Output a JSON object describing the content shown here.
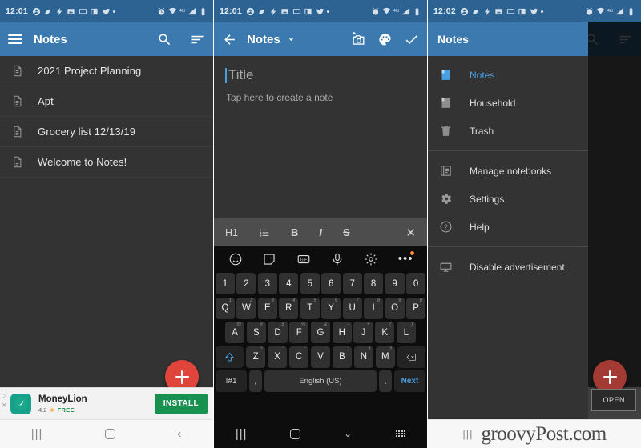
{
  "colors": {
    "appbar_blue": "#3b79ae",
    "statusbar_blue": "#2d6392",
    "body_dark": "#333333",
    "fab_red": "#e0453c",
    "accent_blue": "#4a9fe0",
    "keyboard_black": "#0d0d0d",
    "ad_green": "#17914f"
  },
  "panel1": {
    "status": {
      "time": "12:01",
      "icons": [
        "account-icon",
        "leaf-icon",
        "flash-icon",
        "image-icon",
        "monitor-icon",
        "book-icon",
        "twitter-icon",
        "dot-icon"
      ],
      "right_icons": [
        "alarm-icon",
        "wifi-icon",
        "4g-label",
        "signal-icon",
        "battery-icon"
      ],
      "network_label": "4G"
    },
    "appbar": {
      "menu_icon": "hamburger-icon",
      "title": "Notes",
      "search_icon": "search-icon",
      "sort_icon": "sort-icon"
    },
    "notes": [
      {
        "icon": "document-icon",
        "label": "2021 Project Planning"
      },
      {
        "icon": "document-icon",
        "label": "Apt"
      },
      {
        "icon": "document-icon",
        "label": "Grocery list 12/13/19"
      },
      {
        "icon": "document-icon",
        "label": "Welcome to Notes!"
      }
    ],
    "fab": {
      "icon": "plus-icon",
      "label": "+"
    },
    "ad": {
      "title": "MoneyLion",
      "rating": "4.2",
      "star": "★",
      "price": "FREE",
      "button": "INSTALL",
      "logo_icon": "moneylion-logo-icon"
    },
    "navbar": {
      "recents": "|||",
      "home": "home-circle-icon",
      "back": "‹"
    }
  },
  "panel2": {
    "status": {
      "time": "12:01"
    },
    "appbar": {
      "back_icon": "back-arrow-icon",
      "title": "Notes",
      "dropdown_icon": "chevron-down-icon",
      "camera_icon": "add-photo-icon",
      "palette_icon": "palette-icon",
      "check_icon": "check-icon"
    },
    "editor": {
      "title_placeholder": "Title",
      "body_placeholder": "Tap here to create a note"
    },
    "format_bar": {
      "items": [
        "H1",
        "bullet-list-icon",
        "B",
        "I",
        "S"
      ],
      "close": "✕"
    },
    "kb_toolbar": {
      "items": [
        "emoji-icon",
        "sticker-icon",
        "GIF",
        "mic-icon",
        "settings-icon",
        "more-icon"
      ],
      "gif_label": "GIF"
    },
    "keyboard": {
      "row1": [
        "1",
        "2",
        "3",
        "4",
        "5",
        "6",
        "7",
        "8",
        "9",
        "0"
      ],
      "row2": [
        {
          "k": "Q",
          "alt": "1"
        },
        {
          "k": "W",
          "alt": "2"
        },
        {
          "k": "E",
          "alt": "3"
        },
        {
          "k": "R",
          "alt": "4"
        },
        {
          "k": "T",
          "alt": "5"
        },
        {
          "k": "Y",
          "alt": "6"
        },
        {
          "k": "U",
          "alt": "7"
        },
        {
          "k": "I",
          "alt": "8"
        },
        {
          "k": "O",
          "alt": "9"
        },
        {
          "k": "P",
          "alt": "0"
        }
      ],
      "row3": [
        {
          "k": "A",
          "alt": "@"
        },
        {
          "k": "S",
          "alt": "#"
        },
        {
          "k": "D",
          "alt": "$"
        },
        {
          "k": "F",
          "alt": "%"
        },
        {
          "k": "G",
          "alt": "&"
        },
        {
          "k": "H",
          "alt": "-"
        },
        {
          "k": "J",
          "alt": "+"
        },
        {
          "k": "K",
          "alt": "("
        },
        {
          "k": "L",
          "alt": ")"
        }
      ],
      "row4": [
        {
          "k": "Z",
          "alt": "*"
        },
        {
          "k": "X",
          "alt": "\""
        },
        {
          "k": "C",
          "alt": "'"
        },
        {
          "k": "V",
          "alt": ":"
        },
        {
          "k": "B",
          "alt": ";"
        },
        {
          "k": "N",
          "alt": "!"
        },
        {
          "k": "M",
          "alt": "?"
        }
      ],
      "shift": "shift-icon",
      "backspace": "backspace-icon",
      "symbols": "!#1",
      "comma": ",",
      "space": "English (US)",
      "period": ".",
      "next": "Next"
    },
    "navbar": {
      "recents": "|||",
      "home": "home-circle-icon",
      "down": "chevron-down-icon",
      "keyboard": "keyboard-icon"
    }
  },
  "panel3": {
    "status": {
      "time": "12:02"
    },
    "appbar": {
      "title": "Notes",
      "search_icon": "search-icon",
      "sort_icon": "sort-icon"
    },
    "drawer": {
      "header": "Notes",
      "notebooks": [
        {
          "icon": "notebook-icon",
          "label": "Notes",
          "active": true
        },
        {
          "icon": "notebook-icon",
          "label": "Household",
          "active": false
        },
        {
          "icon": "trash-icon",
          "label": "Trash",
          "active": false
        }
      ],
      "actions": [
        {
          "icon": "manage-notebooks-icon",
          "label": "Manage notebooks"
        },
        {
          "icon": "gear-icon",
          "label": "Settings"
        },
        {
          "icon": "help-icon",
          "label": "Help"
        }
      ],
      "footer": [
        {
          "icon": "monitor-ad-icon",
          "label": "Disable advertisement"
        }
      ]
    },
    "fab": {
      "label": "+"
    },
    "ad": {
      "button": "OPEN"
    },
    "watermark": {
      "bars": "|||",
      "text": "groovyPost.com"
    }
  }
}
